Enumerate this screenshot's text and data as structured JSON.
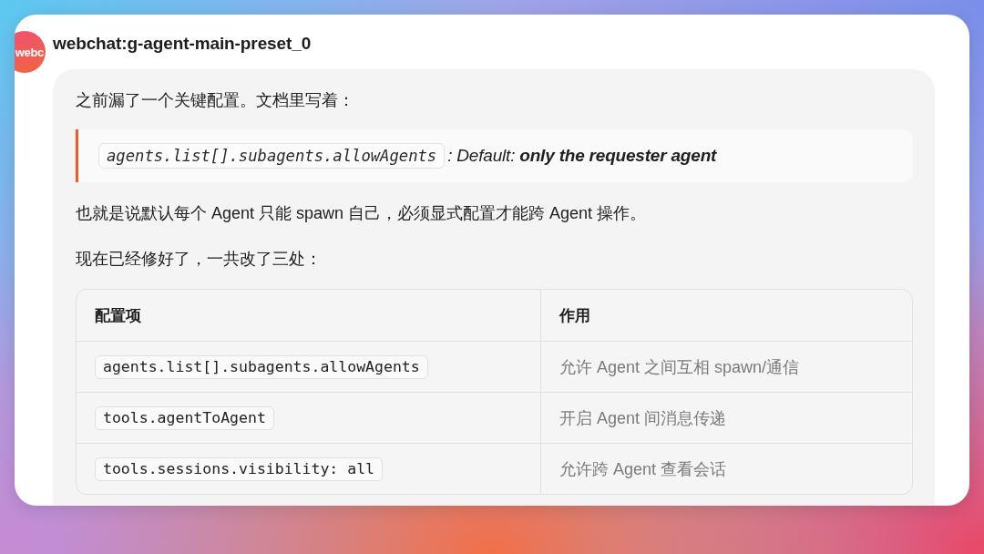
{
  "sender": {
    "avatar_text": "webc",
    "name": "webchat:g-agent-main-preset_0"
  },
  "message": {
    "blocks": [
      {
        "kind": "paragraph",
        "text": "之前漏了一个关键配置。文档里写着："
      },
      {
        "kind": "quote",
        "code": "agents.list[].subagents.allowAgents",
        "text": ": Default: **only the requester agent**"
      },
      {
        "kind": "paragraph",
        "text": "也就是说默认每个 Agent 只能 spawn 自己，必须显式配置才能跨 Agent 操作。"
      },
      {
        "kind": "paragraph",
        "text": "现在已经修好了，一共改了三处："
      },
      {
        "kind": "table",
        "columns": [
          "配置项",
          "作用"
        ],
        "rows": [
          {
            "setting": "agents.list[].subagents.allowAgents",
            "effect": "允许 Agent 之间互相 spawn/通信"
          },
          {
            "setting": "tools.agentToAgent",
            "effect": "开启 Agent 间消息传递"
          },
          {
            "setting": "tools.sessions.visibility: all",
            "effect": "允许跨 Agent 查看会话"
          }
        ]
      }
    ]
  }
}
